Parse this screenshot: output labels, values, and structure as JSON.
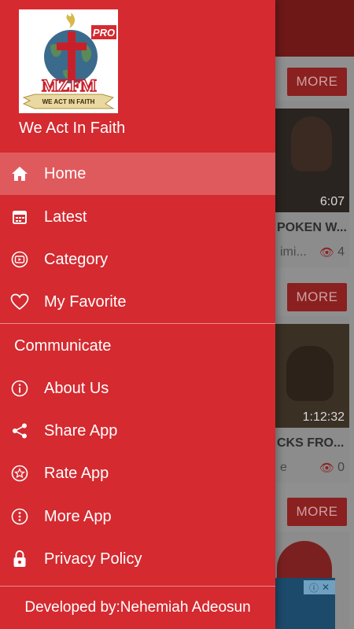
{
  "drawer": {
    "logo": {
      "badge": "PRO",
      "letters": "MZFM",
      "ribbon": "WE ACT IN FAITH"
    },
    "app_name": "We Act In Faith",
    "items": [
      {
        "label": "Home",
        "icon": "home-icon",
        "active": true
      },
      {
        "label": "Latest",
        "icon": "calendar-icon",
        "active": false
      },
      {
        "label": "Category",
        "icon": "video-play-icon",
        "active": false
      },
      {
        "label": "My Favorite",
        "icon": "heart-icon",
        "active": false
      }
    ],
    "section": "Communicate",
    "communicate_items": [
      {
        "label": "About Us",
        "icon": "info-icon"
      },
      {
        "label": "Share App",
        "icon": "share-icon"
      },
      {
        "label": "Rate App",
        "icon": "star-icon"
      },
      {
        "label": "More App",
        "icon": "more-vertical-icon"
      },
      {
        "label": "Privacy Policy",
        "icon": "lock-icon"
      }
    ],
    "footer": "Developed by:Nehemiah Adeosun",
    "colors": {
      "drawer_bg": "#d42a30",
      "active_bg": "#df5a5d"
    }
  },
  "background": {
    "more_label": "MORE",
    "videos": [
      {
        "duration": "6:07",
        "title": "POKEN W...",
        "channel": "imi...",
        "views": "4"
      },
      {
        "duration": "1:12:32",
        "title": "CKS FRO...",
        "channel": "e",
        "views": "0"
      }
    ]
  }
}
